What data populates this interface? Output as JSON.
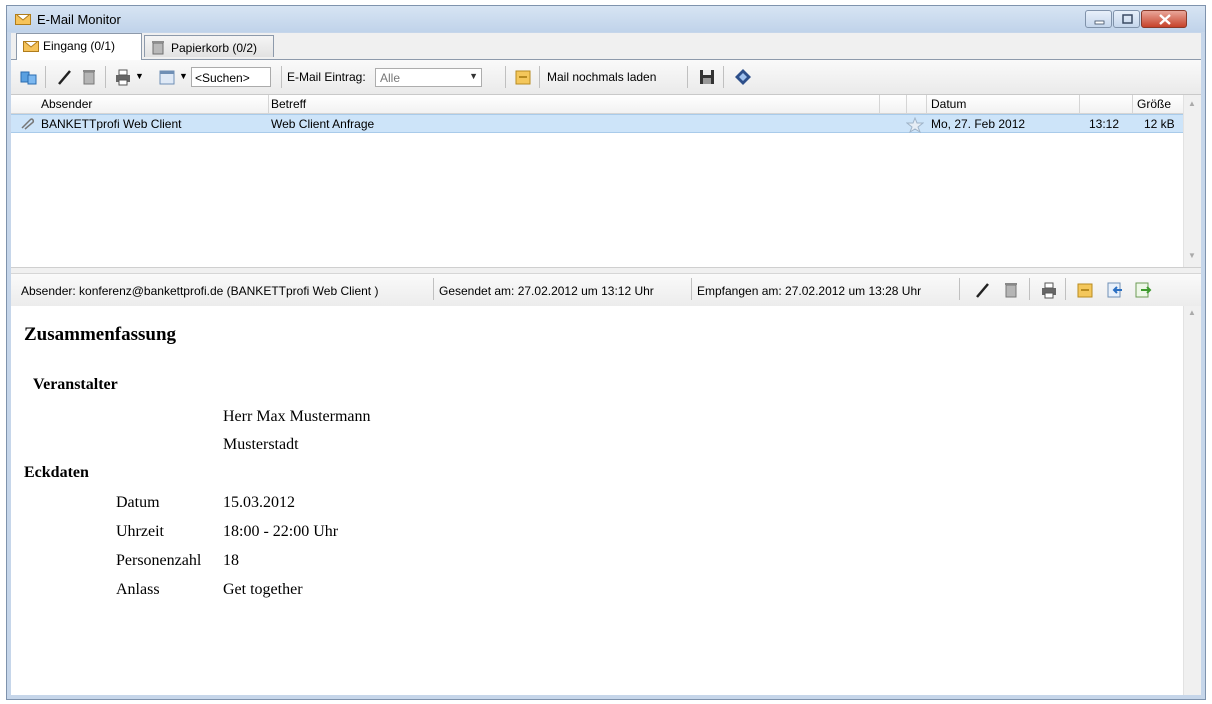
{
  "window": {
    "title": "E-Mail Monitor",
    "icon": "mail-folder-icon",
    "controls": [
      "minimize",
      "maximize",
      "close"
    ]
  },
  "tabs": [
    {
      "label": "Eingang (0/1)",
      "icon": "inbox-icon",
      "active": true
    },
    {
      "label": "Papierkorb (0/2)",
      "icon": "trash-icon",
      "active": false
    }
  ],
  "toolbar": {
    "search_label": "<Suchen>",
    "entry_label": "E-Mail Eintrag:",
    "entry_value": "Alle",
    "reload_label": "Mail nochmals laden",
    "icons": [
      "refresh-icon",
      "edit-icon",
      "delete-icon",
      "print-icon",
      "calendar-icon",
      "archive-icon",
      "save-icon",
      "tag-icon"
    ]
  },
  "grid": {
    "columns": [
      "Absender",
      "Betreff",
      "Datum",
      "Größe"
    ],
    "rows": [
      {
        "absender": "BANKETTprofi Web Client",
        "betreff": "Web Client Anfrage",
        "datum": "Mo, 27. Feb 2012",
        "zeit": "13:12",
        "groesse": "12 kB",
        "selected": true
      }
    ]
  },
  "info": {
    "absender": "Absender: konferenz@bankettprofi.de (BANKETTprofi Web Client )",
    "gesendet": "Gesendet am: 27.02.2012 um 13:12 Uhr",
    "empfangen": "Empfangen am: 27.02.2012 um 13:28 Uhr"
  },
  "message": {
    "title": "Zusammenfassung",
    "veranstalter_heading": "Veranstalter",
    "veranstalter_name": "Herr Max Mustermann",
    "veranstalter_ort": "Musterstadt",
    "eckdaten_heading": "Eckdaten",
    "eckdaten": [
      {
        "label": "Datum",
        "value": "15.03.2012"
      },
      {
        "label": "Uhrzeit",
        "value": "18:00 - 22:00 Uhr"
      },
      {
        "label": "Personenzahl",
        "value": "18"
      },
      {
        "label": "Anlass",
        "value": "Get together"
      }
    ]
  },
  "colors": {
    "selection": "#cde4f9",
    "titlebar": "#c6d6ea"
  }
}
